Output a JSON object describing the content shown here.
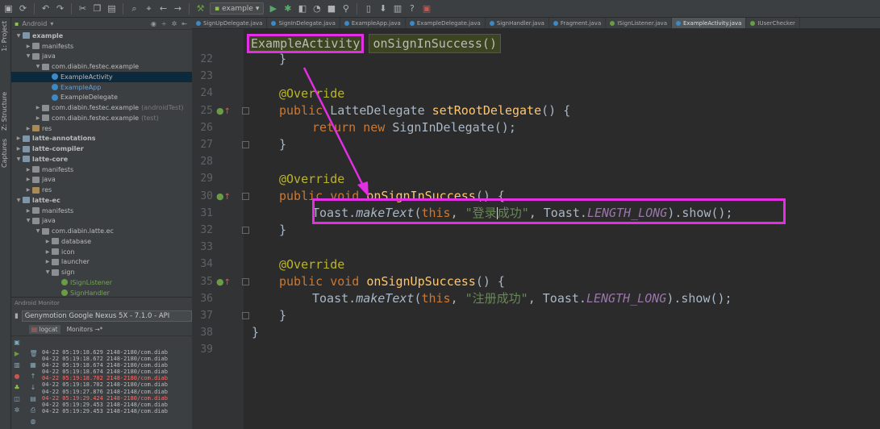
{
  "toolbar": {
    "run_config": "example",
    "icons": [
      "save-icon",
      "sync-icon",
      "undo-icon",
      "redo-icon",
      "cut-icon",
      "copy-icon",
      "paste-icon",
      "find-icon",
      "replace-icon",
      "back-icon",
      "forward-icon",
      "build-icon",
      "run-icon",
      "debug-icon",
      "coverage-icon",
      "profile-icon",
      "stop-icon",
      "attach-icon",
      "avd-icon",
      "sdk-icon",
      "help-icon",
      "monitor-icon"
    ]
  },
  "left_strip": {
    "project": "1: Project",
    "structure": "Z: Structure",
    "captures": "Captures"
  },
  "project_panel": {
    "view": "Android",
    "tree": [
      {
        "label": "example",
        "indent": 0,
        "arrow": "▼",
        "icon": "module",
        "style": "bold"
      },
      {
        "label": "manifests",
        "indent": 1,
        "arrow": "▶",
        "icon": "folder"
      },
      {
        "label": "java",
        "indent": 1,
        "arrow": "▼",
        "icon": "folder"
      },
      {
        "label": "com.diabin.festec.example",
        "indent": 2,
        "arrow": "▼",
        "icon": "folder"
      },
      {
        "label": "ExampleActivity",
        "indent": 3,
        "arrow": "",
        "icon": "class",
        "selected": true
      },
      {
        "label": "ExampleApp",
        "indent": 3,
        "arrow": "",
        "icon": "class",
        "style": "blue"
      },
      {
        "label": "ExampleDelegate",
        "indent": 3,
        "arrow": "",
        "icon": "class"
      },
      {
        "label": "com.diabin.festec.example",
        "suffix": "(androidTest)",
        "indent": 2,
        "arrow": "▶",
        "icon": "folder"
      },
      {
        "label": "com.diabin.festec.example",
        "suffix": "(test)",
        "indent": 2,
        "arrow": "▶",
        "icon": "folder"
      },
      {
        "label": "res",
        "indent": 1,
        "arrow": "▶",
        "icon": "res"
      },
      {
        "label": "latte-annotations",
        "indent": 0,
        "arrow": "▶",
        "icon": "module",
        "style": "bold"
      },
      {
        "label": "latte-compiler",
        "indent": 0,
        "arrow": "▶",
        "icon": "module",
        "style": "bold"
      },
      {
        "label": "latte-core",
        "indent": 0,
        "arrow": "▼",
        "icon": "module",
        "style": "bold"
      },
      {
        "label": "manifests",
        "indent": 1,
        "arrow": "▶",
        "icon": "folder"
      },
      {
        "label": "java",
        "indent": 1,
        "arrow": "▶",
        "icon": "folder"
      },
      {
        "label": "res",
        "indent": 1,
        "arrow": "▶",
        "icon": "res"
      },
      {
        "label": "latte-ec",
        "indent": 0,
        "arrow": "▼",
        "icon": "module",
        "style": "bold"
      },
      {
        "label": "manifests",
        "indent": 1,
        "arrow": "▶",
        "icon": "folder"
      },
      {
        "label": "java",
        "indent": 1,
        "arrow": "▼",
        "icon": "folder"
      },
      {
        "label": "com.diabin.latte.ec",
        "indent": 2,
        "arrow": "▼",
        "icon": "folder"
      },
      {
        "label": "database",
        "indent": 3,
        "arrow": "▶",
        "icon": "folder"
      },
      {
        "label": "icon",
        "indent": 3,
        "arrow": "▶",
        "icon": "folder"
      },
      {
        "label": "launcher",
        "indent": 3,
        "arrow": "▶",
        "icon": "folder"
      },
      {
        "label": "sign",
        "indent": 3,
        "arrow": "▼",
        "icon": "folder"
      },
      {
        "label": "ISignListener",
        "indent": 4,
        "arrow": "",
        "icon": "iface",
        "style": "green"
      },
      {
        "label": "SignHandler",
        "indent": 4,
        "arrow": "",
        "icon": "iface",
        "style": "green"
      }
    ]
  },
  "monitor": {
    "title": "Android Monitor",
    "device": "Genymotion Google Nexus 5X - 7.1.0 - API",
    "tab_logcat": "logcat",
    "tab_monitors": "Monitors",
    "log_lines": [
      {
        "text": "04-22 05:19:18.629 2148-2180/com.diab",
        "level": "info"
      },
      {
        "text": "04-22 05:19:18.672 2148-2180/com.diab",
        "level": "info"
      },
      {
        "text": "04-22 05:19:18.674 2148-2180/com.diab",
        "level": "info"
      },
      {
        "text": "04-22 05:19:18.674 2148-2180/com.diab",
        "level": "info"
      },
      {
        "text": "04-22 05:19:18.702 2148-2180/com.diab",
        "level": "error"
      },
      {
        "text": "04-22 05:19:18.702 2148-2180/com.diab",
        "level": "info"
      },
      {
        "text": "04-22 05:19:27.876 2148-2148/com.diab",
        "level": "info"
      },
      {
        "text": "04-22 05:19:29.424 2148-2180/com.diab",
        "level": "error"
      },
      {
        "text": "04-22 05:19:29.453 2148-2148/com.diab",
        "level": "info"
      },
      {
        "text": "04-22 05:19:29.453 2148-2148/com.diab",
        "level": "info"
      }
    ]
  },
  "tabs": [
    {
      "label": "SignUpDelegate.java",
      "icon": "class"
    },
    {
      "label": "SignInDelegate.java",
      "icon": "class"
    },
    {
      "label": "ExampleApp.java",
      "icon": "class"
    },
    {
      "label": "ExampleDelegate.java",
      "icon": "class"
    },
    {
      "label": "SignHandler.java",
      "icon": "class"
    },
    {
      "label": "Fragment.java",
      "icon": "class"
    },
    {
      "label": "ISignListener.java",
      "icon": "iface"
    },
    {
      "label": "ExampleActivity.java",
      "icon": "class",
      "active": true
    },
    {
      "label": "IUserChecker",
      "icon": "iface"
    }
  ],
  "breadcrumbs": {
    "class_name": "ExampleActivity",
    "method_name": "onSignInSuccess()"
  },
  "editor": {
    "line_numbers": [
      "22",
      "23",
      "24",
      "25",
      "26",
      "27",
      "28",
      "29",
      "30",
      "31",
      "32",
      "33",
      "34",
      "35",
      "36",
      "37",
      "38",
      "39"
    ],
    "code": {
      "l22": "}",
      "l24": "@Override",
      "l25_kw": "public",
      "l25_type": " LatteDelegate ",
      "l25_fn": "setRootDelegate",
      "l25_end": "() {",
      "l26_kw1": "return",
      "l26_kw2": "new",
      "l26_rest": " SignInDelegate();",
      "l27": "}",
      "l29": "@Override",
      "l30_kw": "public void",
      "l30_fn": "onSignInSuccess",
      "l30_end": "() {",
      "l31_a": "Toast.",
      "l31_method": "makeText",
      "l31_b": "(",
      "l31_this": "this",
      "l31_c": ", ",
      "l31_str1": "\"登录",
      "l31_str2": "成功\"",
      "l31_d": ", Toast.",
      "l31_const": "LENGTH_LONG",
      "l31_e": ").show();",
      "l32": "}",
      "l34": "@Override",
      "l35_kw": "public void",
      "l35_fn": "onSignUpSuccess",
      "l35_end": "() {",
      "l36_a": "Toast.",
      "l36_method": "makeText",
      "l36_b": "(",
      "l36_this": "this",
      "l36_c": ", ",
      "l36_str": "\"注册成功\"",
      "l36_d": ", Toast.",
      "l36_const": "LENGTH_LONG",
      "l36_e": ").show();",
      "l37": "}",
      "l38": "}"
    }
  },
  "colors": {
    "annotation_magenta": "#e22fe3",
    "keyword": "#cc7832",
    "string": "#6a8759",
    "function": "#ffc66d",
    "constant": "#9876aa"
  }
}
